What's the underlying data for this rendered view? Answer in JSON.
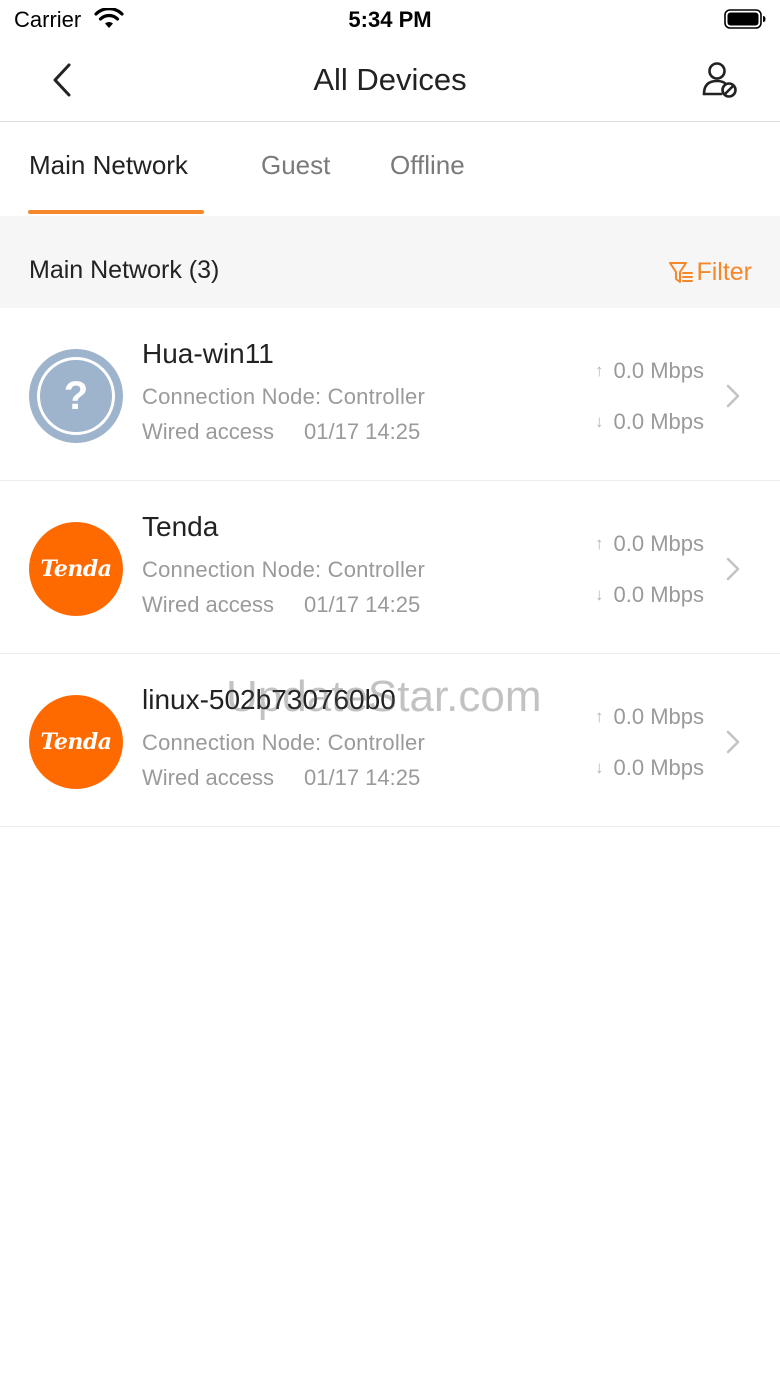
{
  "status_bar": {
    "carrier": "Carrier",
    "time": "5:34 PM"
  },
  "nav": {
    "title": "All Devices",
    "back_icon": "chevron-left-icon",
    "user_icon": "user-block-icon"
  },
  "tabs": [
    {
      "label": "Main Network",
      "active": true
    },
    {
      "label": "Guest",
      "active": false
    },
    {
      "label": "Offline",
      "active": false
    }
  ],
  "section": {
    "title": "Main Network (3)",
    "filter_label": "Filter"
  },
  "devices": [
    {
      "name": "Hua-win11",
      "avatar": "unknown",
      "node": "Connection Node: Controller",
      "access": "Wired access",
      "time": "01/17 14:25",
      "up": "0.0 Mbps",
      "down": "0.0 Mbps"
    },
    {
      "name": "Tenda",
      "avatar": "tenda",
      "node": "Connection Node: Controller",
      "access": "Wired access",
      "time": "01/17 14:25",
      "up": "0.0 Mbps",
      "down": "0.0 Mbps"
    },
    {
      "name": "linux-502b730760b0",
      "avatar": "tenda",
      "node": "Connection Node: Controller",
      "access": "Wired access",
      "time": "01/17 14:25",
      "up": "0.0 Mbps",
      "down": "0.0 Mbps"
    }
  ],
  "avatar_labels": {
    "unknown": "?",
    "tenda": "Tenda"
  },
  "arrows": {
    "up": "↑",
    "down": "↓"
  },
  "watermark": "UpdateStar.com",
  "colors": {
    "accent": "#f5882a",
    "tenda_orange": "#ff6a00",
    "unknown_avatar": "#9eb4cc"
  }
}
